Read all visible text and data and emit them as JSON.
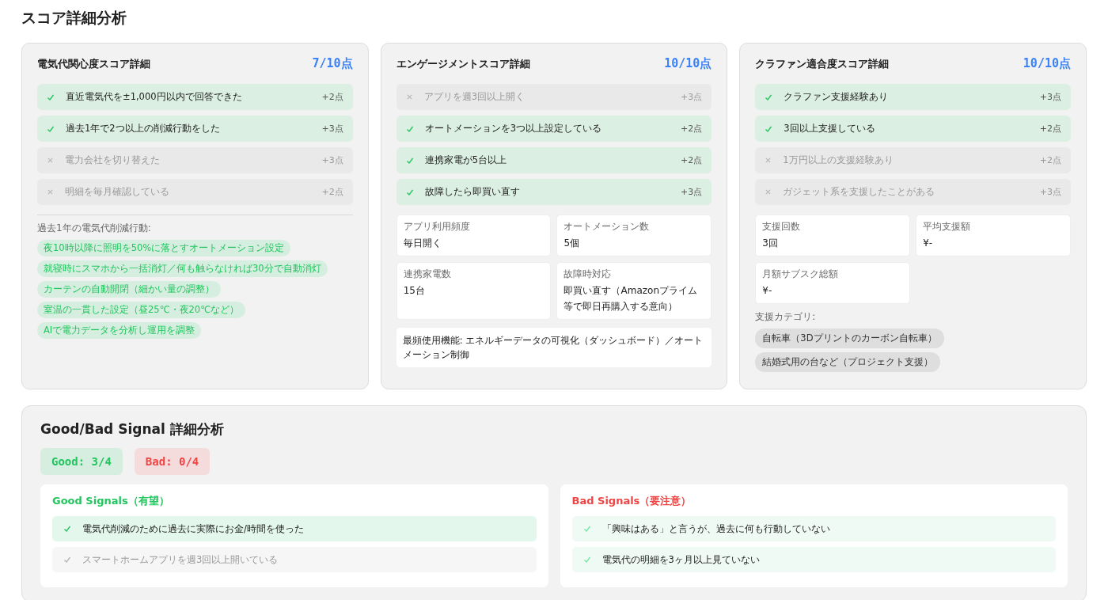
{
  "title": "スコア詳細分析",
  "score_cards": [
    {
      "title": "電気代関心度スコア詳細",
      "score": "7/10点",
      "criteria": [
        {
          "label": "直近電気代を±1,000円以内で回答できた",
          "points": "+2点",
          "met": true
        },
        {
          "label": "過去1年で2つ以上の削減行動をした",
          "points": "+3点",
          "met": true
        },
        {
          "label": "電力会社を切り替えた",
          "points": "+3点",
          "met": false
        },
        {
          "label": "明細を毎月確認している",
          "points": "+2点",
          "met": false
        }
      ],
      "tags_label": "過去1年の電気代削減行動:",
      "tags": [
        "夜10時以降に照明を50%に落とすオートメーション設定",
        "就寝時にスマホから一括消灯／何も触らなければ30分で自動消灯",
        "カーテンの自動開閉（細かい量の調整）",
        "室温の一貫した設定（昼25℃・夜20℃など）",
        "AIで電力データを分析し運用を調整"
      ]
    },
    {
      "title": "エンゲージメントスコア詳細",
      "score": "10/10点",
      "criteria": [
        {
          "label": "アプリを週3回以上開く",
          "points": "+3点",
          "met": false
        },
        {
          "label": "オートメーションを3つ以上設定している",
          "points": "+2点",
          "met": true
        },
        {
          "label": "連携家電が5台以上",
          "points": "+2点",
          "met": true
        },
        {
          "label": "故障したら即買い直す",
          "points": "+3点",
          "met": true
        }
      ],
      "stats": [
        {
          "label": "アプリ利用頻度",
          "value": "毎日開く"
        },
        {
          "label": "オートメーション数",
          "value": "5個"
        },
        {
          "label": "連携家電数",
          "value": "15台"
        },
        {
          "label": "故障時対応",
          "value": "即買い直す（Amazonプライム等で即日再購入する意向）"
        }
      ],
      "note": "最頻使用機能: エネルギーデータの可視化（ダッシュボード）／オートメーション制御"
    },
    {
      "title": "クラファン適合度スコア詳細",
      "score": "10/10点",
      "criteria": [
        {
          "label": "クラファン支援経験あり",
          "points": "+3点",
          "met": true
        },
        {
          "label": "3回以上支援している",
          "points": "+2点",
          "met": true
        },
        {
          "label": "1万円以上の支援経験あり",
          "points": "+2点",
          "met": false
        },
        {
          "label": "ガジェット系を支援したことがある",
          "points": "+3点",
          "met": false
        }
      ],
      "stats": [
        {
          "label": "支援回数",
          "value": "3回"
        },
        {
          "label": "平均支援額",
          "value": "¥-"
        },
        {
          "label": "月額サブスク総額",
          "value": "¥-"
        }
      ],
      "tags_label": "支援カテゴリ:",
      "tags": [
        "自転車（3Dプリントのカーボン自転車）",
        "結婚式用の台など（プロジェクト支援）"
      ]
    }
  ],
  "signals": {
    "title": "Good/Bad Signal 詳細分析",
    "good_count": "Good: 3/4",
    "bad_count": "Bad: 0/4",
    "good": {
      "title": "Good Signals（有望）",
      "items": [
        {
          "label": "電気代削減のために過去に実際にお金/時間を使った",
          "met": true
        },
        {
          "label": "スマートホームアプリを週3回以上開いている",
          "met": false
        }
      ]
    },
    "bad": {
      "title": "Bad Signals（要注意）",
      "items": [
        {
          "label": "「興味はある」と言うが、過去に何も行動していない",
          "triggered": false
        },
        {
          "label": "電気代の明細を3ヶ月以上見ていない",
          "triggered": false
        }
      ]
    }
  }
}
